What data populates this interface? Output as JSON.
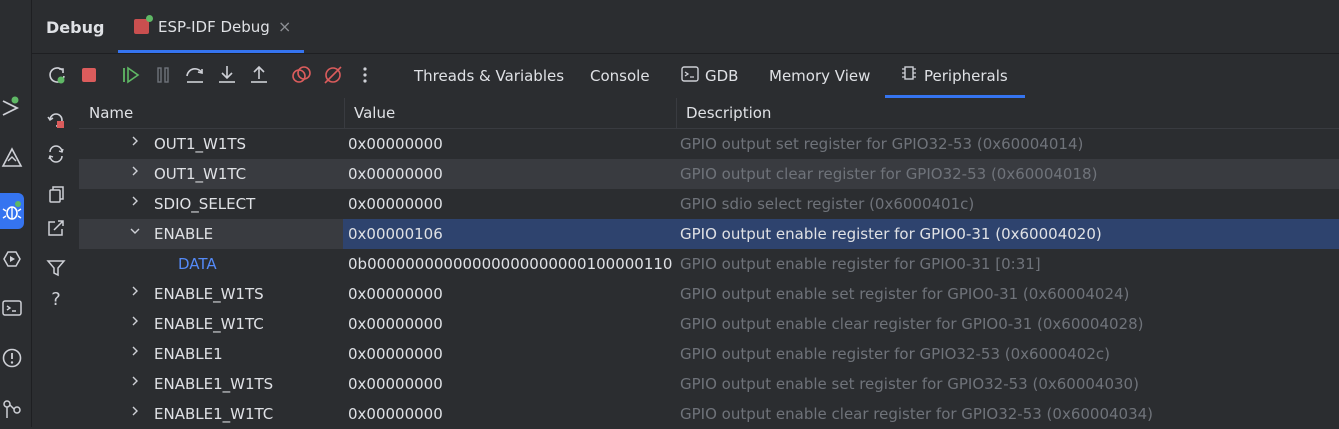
{
  "header": {
    "panel_title": "Debug",
    "session_tab": "ESP-IDF Debug",
    "close_glyph": "×"
  },
  "toolbar": {
    "icons": [
      "rerun-icon",
      "stop-icon",
      "resume-icon",
      "pause-icon",
      "step-over-icon",
      "step-into-icon",
      "step-out-icon",
      "view-breakpoints-icon",
      "mute-breakpoints-icon",
      "more-icon"
    ],
    "tabs": [
      "Threads & Variables",
      "Console",
      "GDB",
      "Memory View",
      "Peripherals"
    ],
    "active_tab": "Peripherals"
  },
  "table": {
    "columns": [
      "Name",
      "Value",
      "Description"
    ],
    "rows": [
      {
        "name": "OUT1_W1TS",
        "value": "0x00000000",
        "description": "GPIO output set register for GPIO32-53 (0x60004014)",
        "state": "collapsed"
      },
      {
        "name": "OUT1_W1TC",
        "value": "0x00000000",
        "description": "GPIO output clear register for GPIO32-53 (0x60004018)",
        "state": "collapsed"
      },
      {
        "name": "SDIO_SELECT",
        "value": "0x00000000",
        "description": "GPIO sdio select register (0x6000401c)",
        "state": "collapsed"
      },
      {
        "name": "ENABLE",
        "value": "0x00000106",
        "description": "GPIO output enable register for GPIO0-31 (0x60004020)",
        "state": "expanded"
      },
      {
        "name": "DATA",
        "value": "0b00000000000000000000000100000110",
        "description": "GPIO output enable register for GPIO0-31 [0:31]",
        "state": "leaf"
      },
      {
        "name": "ENABLE_W1TS",
        "value": "0x00000000",
        "description": "GPIO output enable set register for GPIO0-31 (0x60004024)",
        "state": "collapsed"
      },
      {
        "name": "ENABLE_W1TC",
        "value": "0x00000000",
        "description": "GPIO output enable clear register for GPIO0-31 (0x60004028)",
        "state": "collapsed"
      },
      {
        "name": "ENABLE1",
        "value": "0x00000000",
        "description": "GPIO output enable register for GPIO32-53 (0x6000402c)",
        "state": "collapsed"
      },
      {
        "name": "ENABLE1_W1TS",
        "value": "0x00000000",
        "description": "GPIO output enable set register for GPIO32-53 (0x60004030)",
        "state": "collapsed"
      },
      {
        "name": "ENABLE1_W1TC",
        "value": "0x00000000",
        "description": "GPIO output enable clear register for GPIO32-53 (0x60004034)",
        "state": "collapsed"
      }
    ]
  },
  "colors": {
    "accent": "#3574f0",
    "selection": "#2e436e",
    "child_name": "#548af7",
    "muted_text": "#6f737a"
  }
}
